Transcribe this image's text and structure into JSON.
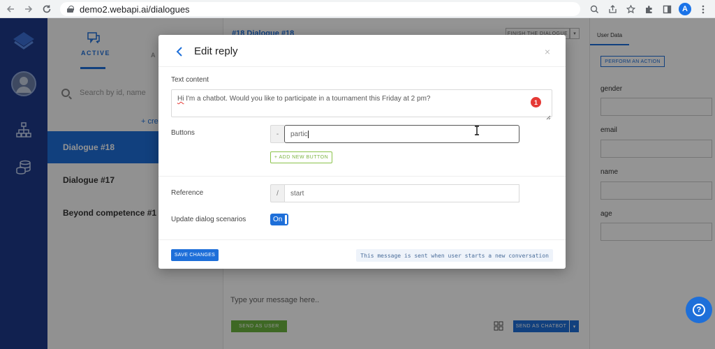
{
  "browser": {
    "url": "demo2.webapi.ai/dialogues",
    "profile_initial": "A",
    "icons": [
      "back-icon",
      "forward-icon",
      "reload-icon",
      "lock-icon",
      "zoom-icon",
      "share-icon",
      "star-icon",
      "extensions-icon",
      "sidepanel-icon",
      "menu-icon"
    ]
  },
  "rail": {
    "icons": [
      "logo-icon",
      "avatar",
      "sitemap-icon",
      "database-icon"
    ]
  },
  "list_panel": {
    "tab_active_label": "ACTIVE",
    "tab_second_label": "A",
    "search_placeholder": "Search by id, name",
    "create_link": "+ cre",
    "items": [
      {
        "label": "Dialogue #18",
        "selected": true
      },
      {
        "label": "Dialogue #17",
        "selected": false
      },
      {
        "label": "Beyond competence #1",
        "selected": false
      }
    ]
  },
  "center": {
    "title": "#18 Dialogue #18",
    "finish_button": "FINISH THE DIALOGUE",
    "message_placeholder": "Type your message here..",
    "send_as_user": "SEND AS USER",
    "send_as_chatbot": "SEND AS CHATBOT"
  },
  "right_panel": {
    "tab": "User Data",
    "perform_button": "PERFORM AN ACTION",
    "fields": [
      "gender",
      "email",
      "name",
      "age"
    ]
  },
  "modal": {
    "title": "Edit reply",
    "close": "×",
    "text_label": "Text content",
    "text_first_word": "Hi",
    "text_rest": " I'm a chatbot. Would you like to participate in a tournament this Friday at 2 pm?",
    "badge": "1",
    "buttons_label": "Buttons",
    "button_prefix": "-",
    "button_value": "partic",
    "add_button": "+ ADD NEW BUTTON",
    "reference_label": "Reference",
    "reference_prefix": "/",
    "reference_value": "start",
    "update_label": "Update dialog scenarios",
    "toggle_label": "On",
    "toggle_state": "on",
    "save_button": "SAVE CHANGES",
    "note": "This message is sent when user starts a new conversation"
  },
  "colors": {
    "accent": "#1e6fd9",
    "rail": "#1e3a8a",
    "green": "#6cb33f",
    "badge": "#e53935"
  }
}
